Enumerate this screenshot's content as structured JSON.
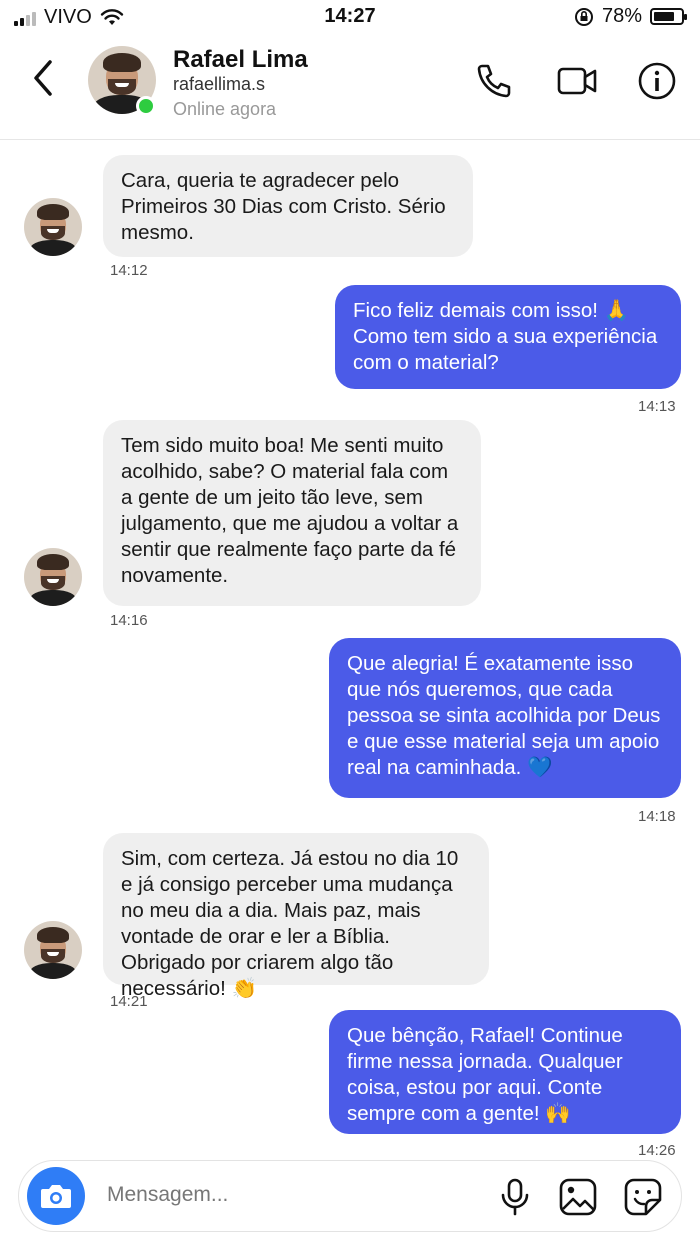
{
  "status_bar": {
    "carrier": "VIVO",
    "time": "14:27",
    "battery": "78%",
    "battery_level": 0.78
  },
  "header": {
    "name": "Rafael Lima",
    "username": "rafaellima.s",
    "status": "Online agora",
    "icons": [
      "back-arrow-icon",
      "phone-icon",
      "video-camera-icon",
      "info-icon"
    ]
  },
  "messages": [
    {
      "direction": "in",
      "text": "Cara, queria te agradecer pelo Primeiros 30 Dias com Cristo. Sério mesmo.",
      "time": "14:12"
    },
    {
      "direction": "out",
      "text": "Fico feliz demais com isso! 🙏 Como tem sido a sua experiência com o material?",
      "time": "14:13"
    },
    {
      "direction": "in",
      "text": "Tem sido muito boa! Me senti muito acolhido, sabe? O material fala com a gente de um jeito tão leve, sem julgamento, que me ajudou a voltar a sentir que realmente faço parte da fé novamente.",
      "time": "14:16"
    },
    {
      "direction": "out",
      "text": "Que alegria! É exatamente isso que nós queremos, que cada pessoa se sinta acolhida por Deus e que esse material seja um apoio real na caminhada. 💙",
      "time": "14:18"
    },
    {
      "direction": "in",
      "text": "Sim, com certeza. Já estou no dia 10 e já consigo perceber uma mudança no meu dia a dia. Mais paz, mais vontade de orar e ler a Bíblia. Obrigado por criarem algo tão necessário! 👏",
      "time": "14:21"
    },
    {
      "direction": "out",
      "text": "Que bênção, Rafael! Continue firme nessa jornada. Qualquer coisa, estou por aqui. Conte sempre com a gente! 🙌",
      "time": "14:26"
    }
  ],
  "composer": {
    "placeholder": "Mensagem...",
    "icons": [
      "camera-icon",
      "microphone-icon",
      "gallery-icon",
      "sticker-icon"
    ]
  },
  "colors": {
    "outgoing_bubble": "#4b5be8",
    "incoming_bubble": "#efefef",
    "online": "#2ecc40",
    "camera_button": "#2f7df6"
  }
}
